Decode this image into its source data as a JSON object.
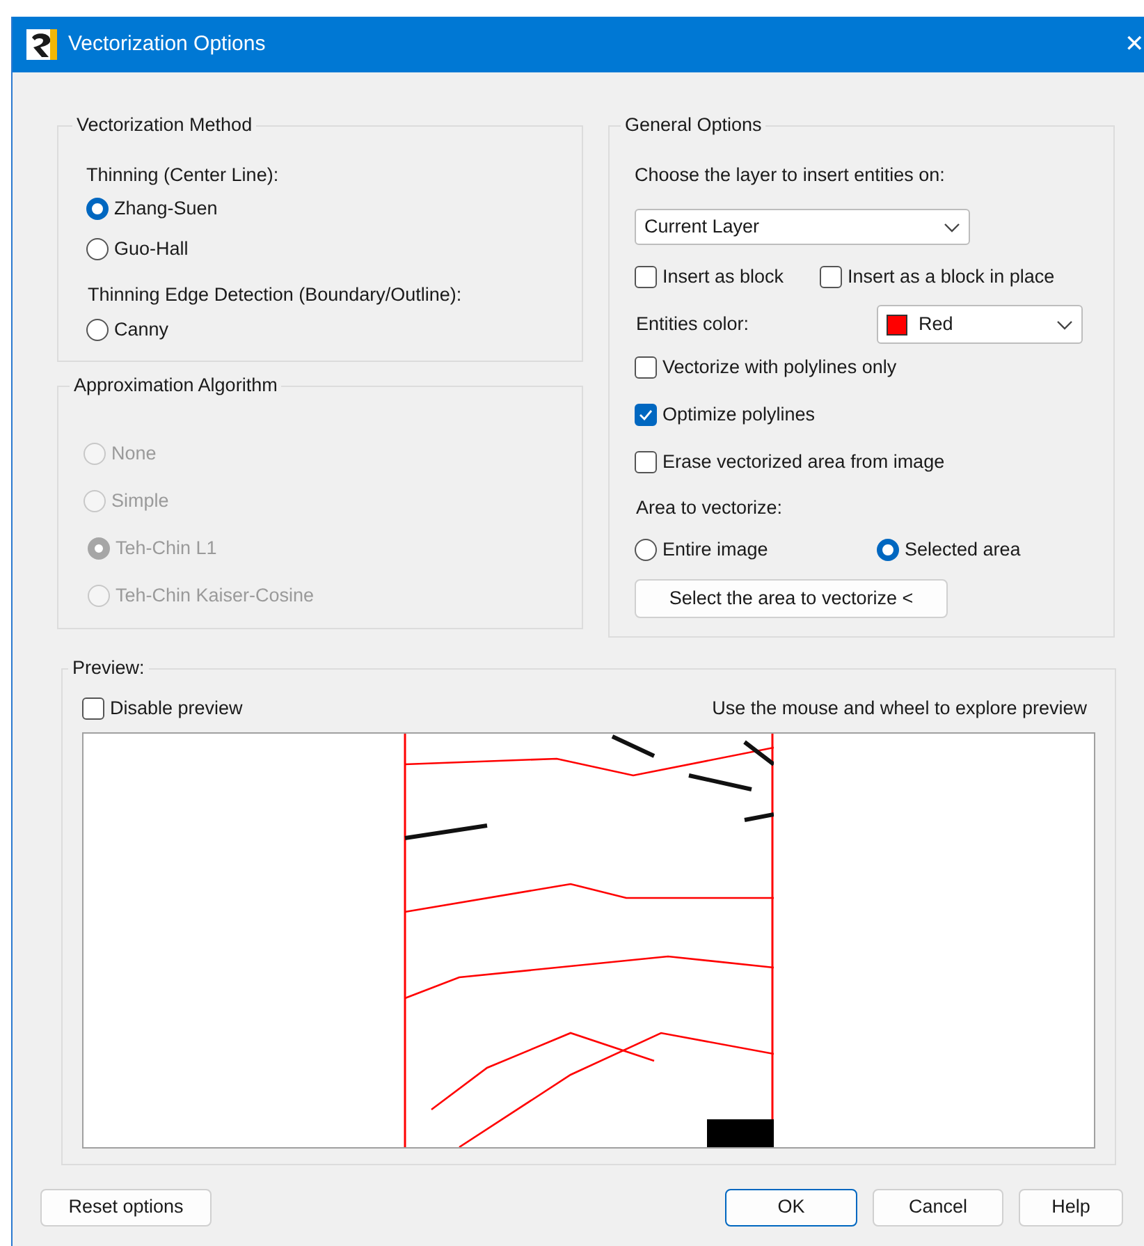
{
  "window": {
    "title": "Vectorization Options",
    "close": "✕"
  },
  "vectorization_method": {
    "title": "Vectorization Method",
    "groups": [
      {
        "label": "Thinning (Center Line):",
        "options": [
          {
            "label": "Zhang-Suen",
            "selected": true
          },
          {
            "label": "Guo-Hall",
            "selected": false
          }
        ]
      },
      {
        "label": "Thinning Edge Detection (Boundary/Outline):",
        "options": [
          {
            "label": "Canny",
            "selected": false
          }
        ]
      }
    ]
  },
  "approximation": {
    "title": "Approximation Algorithm",
    "disabled": true,
    "options": [
      {
        "label": "None",
        "selected": false
      },
      {
        "label": "Simple",
        "selected": false
      },
      {
        "label": "Teh-Chin L1",
        "selected": true
      },
      {
        "label": "Teh-Chin Kaiser-Cosine",
        "selected": false
      }
    ]
  },
  "general_options": {
    "title": "General Options",
    "layer_label": "Choose the layer to insert entities on:",
    "layer_select": "Current Layer",
    "insert_checks": [
      {
        "label": "Insert as block",
        "checked": false
      },
      {
        "label": "Insert as a block in place",
        "checked": false
      }
    ],
    "color_label": "Entities color:",
    "color_select": {
      "value": "Red",
      "color": "#ff0000"
    },
    "checks": [
      {
        "label": "Vectorize with polylines only",
        "checked": false
      },
      {
        "label": "Optimize polylines",
        "checked": true
      },
      {
        "label": "Erase vectorized area from image",
        "checked": false
      }
    ],
    "area_label": "Area to vectorize:",
    "area_options": [
      {
        "label": "Entire image",
        "selected": false
      },
      {
        "label": "Selected area",
        "selected": true
      }
    ],
    "select_button": "Select the area to vectorize <"
  },
  "preview": {
    "title": "Preview:",
    "disable_check": {
      "label": "Disable preview",
      "checked": false
    },
    "hint": "Use the mouse and wheel to explore preview"
  },
  "buttons": [
    {
      "label": "Reset options",
      "default": false
    },
    {
      "label": "OK",
      "default": true
    },
    {
      "label": "Cancel",
      "default": false
    },
    {
      "label": "Help",
      "default": false
    }
  ]
}
